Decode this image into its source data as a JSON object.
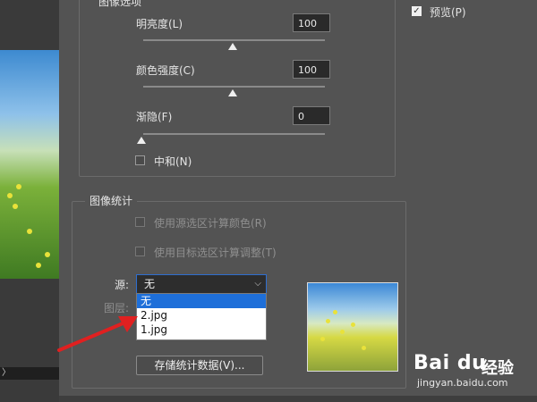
{
  "dialog": {
    "options_group": {
      "title": "图像选项",
      "luminance": {
        "label": "明亮度(L)",
        "value": "100",
        "level": 0.5
      },
      "color_intensity": {
        "label": "颜色强度(C)",
        "value": "100",
        "level": 0.5
      },
      "fade": {
        "label": "渐隐(F)",
        "value": "0",
        "level": 0.0
      },
      "neutralize": {
        "label": "中和(N)",
        "checked": false
      }
    },
    "preview": {
      "label": "预览(P)",
      "checked": true
    },
    "stats_group": {
      "title": "图像统计",
      "use_source_selection": "使用源选区计算颜色(R)",
      "use_target_selection": "使用目标选区计算调整(T)",
      "source_label": "源:",
      "source_value": "无",
      "layer_label": "图层:",
      "source_options": [
        "无",
        "2.jpg",
        "1.jpg"
      ],
      "save_button": "存储统计数据(V)..."
    }
  },
  "canvas_scroll_glyph": "〉",
  "watermark": {
    "logo": "Bai du",
    "cn": "经验",
    "url": "jingyan.baidu.com"
  },
  "colors": {
    "dialog_bg": "#535353",
    "selection_blue": "#1e6fd9",
    "arrow_red": "#e02020"
  }
}
